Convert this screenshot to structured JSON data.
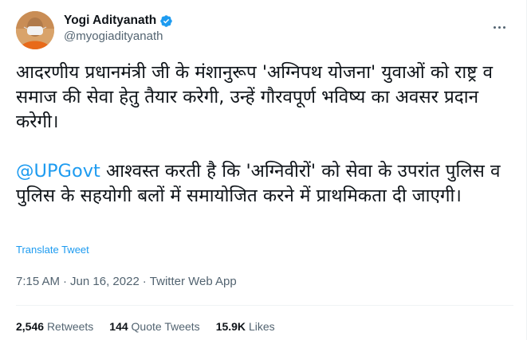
{
  "author": {
    "display_name": "Yogi Adityanath",
    "handle": "@myogiadityanath",
    "verified_badge_icon": "verified-badge-icon",
    "accent_color": "#1d9bf0"
  },
  "tweet": {
    "paragraph1": "आदरणीय प्रधानमंत्री जी के मंशानुरूप 'अग्निपथ योजना' युवाओं को राष्ट्र व समाज की सेवा हेतु तैयार करेगी, उन्हें गौरवपूर्ण भविष्य का अवसर प्रदान करेगी।",
    "mention": "@UPGovt",
    "paragraph2_rest": " आश्वस्त करती है कि 'अग्निवीरों' को सेवा के उपरांत पुलिस व पुलिस के सहयोगी बलों में समायोजित करने में प्राथमिकता दी जाएगी।",
    "translate_label": "Translate Tweet",
    "time": "7:15 AM",
    "separator1": "·",
    "date": "Jun 16, 2022",
    "separator2": "·",
    "source": "Twitter Web App"
  },
  "stats": {
    "retweets_count": "2,546",
    "retweets_label": "Retweets",
    "quotes_count": "144",
    "quotes_label": "Quote Tweets",
    "likes_count": "15.9K",
    "likes_label": "Likes"
  }
}
